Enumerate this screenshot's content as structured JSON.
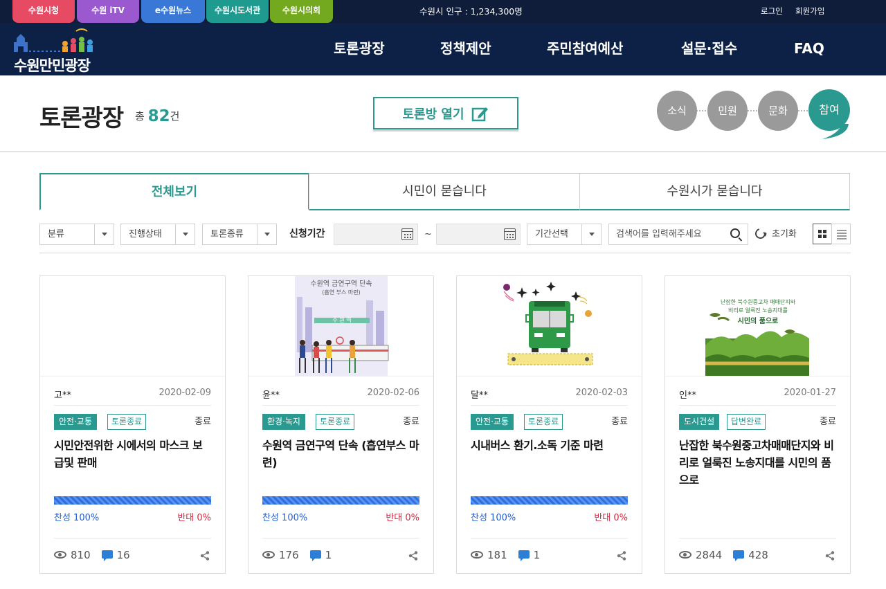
{
  "site_tabs": [
    {
      "label": "수원시청",
      "color": "#e74a63"
    },
    {
      "label": "수원 iTV",
      "color": "#9b59d0"
    },
    {
      "label": "e수원뉴스",
      "color": "#3a78d8"
    },
    {
      "label": "수원시도서관",
      "color": "#1f9a8f"
    },
    {
      "label": "수원시의회",
      "color": "#73a91e"
    }
  ],
  "population": "수원시 인구 : 1,234,300명",
  "util": {
    "login": "로그인",
    "join": "회원가입"
  },
  "logo_text": "수원만민광장",
  "gnb": [
    "토론광장",
    "정책제안",
    "주민참여예산",
    "설문·접수",
    "FAQ"
  ],
  "page": {
    "title": "토론광장",
    "count_prefix": "총",
    "count": "82",
    "count_suffix": "건",
    "open_button": "토론방 열기"
  },
  "quick_circles": [
    "소식",
    "민원",
    "문화",
    "참여"
  ],
  "tabs": [
    "전체보기",
    "시민이 묻습니다",
    "수원시가 묻습니다"
  ],
  "filters": {
    "category": "분류",
    "progress": "진행상태",
    "type": "토론종류",
    "period_label": "신청기간",
    "tilde": "~",
    "period_select": "기간선택",
    "search_placeholder": "검색어를 입력해주세요",
    "reset": "초기화"
  },
  "cards": [
    {
      "author": "고**",
      "date": "2020-02-09",
      "category": "안전·교통",
      "state": "토론종료",
      "status": "종료",
      "title": "시민안전위한 시에서의 마스크 보급및 판매",
      "pro": "찬성 100%",
      "con": "반대 0%",
      "pro_ratio": 1.0,
      "views": "810",
      "comments": "16"
    },
    {
      "author": "윤**",
      "date": "2020-02-06",
      "category": "환경·녹지",
      "state": "토론종료",
      "status": "종료",
      "title": "수원역 금연구역 단속 (흡연부스 마련)",
      "pro": "찬성 100%",
      "con": "반대 0%",
      "pro_ratio": 1.0,
      "views": "176",
      "comments": "1",
      "thumb_text": [
        "수원역 금연구역 단속",
        "(흡연 부스 마련)",
        "수 원 역"
      ]
    },
    {
      "author": "달**",
      "date": "2020-02-03",
      "category": "안전·교통",
      "state": "토론종료",
      "status": "종료",
      "title": "시내버스 환기.소독 기준 마련",
      "pro": "찬성 100%",
      "con": "반대 0%",
      "pro_ratio": 1.0,
      "views": "181",
      "comments": "1"
    },
    {
      "author": "인**",
      "date": "2020-01-27",
      "category": "도시건설",
      "state": "답변완료",
      "status": "종료",
      "title": "난잡한 북수원중고차매매단지와 비리로 얼룩진 노송지대를 시민의 품으로",
      "pro": "",
      "con": "",
      "views": "2844",
      "comments": "428",
      "thumb_text": [
        "난잡한 북수원중고차 매매단지와",
        "비리로 얼룩진 노송지대를",
        "시민의 품으로"
      ]
    }
  ],
  "colors": {
    "accent": "#2a9a91",
    "navy": "#0d2147",
    "pro": "#1f5fd6",
    "con": "#d12a42"
  }
}
